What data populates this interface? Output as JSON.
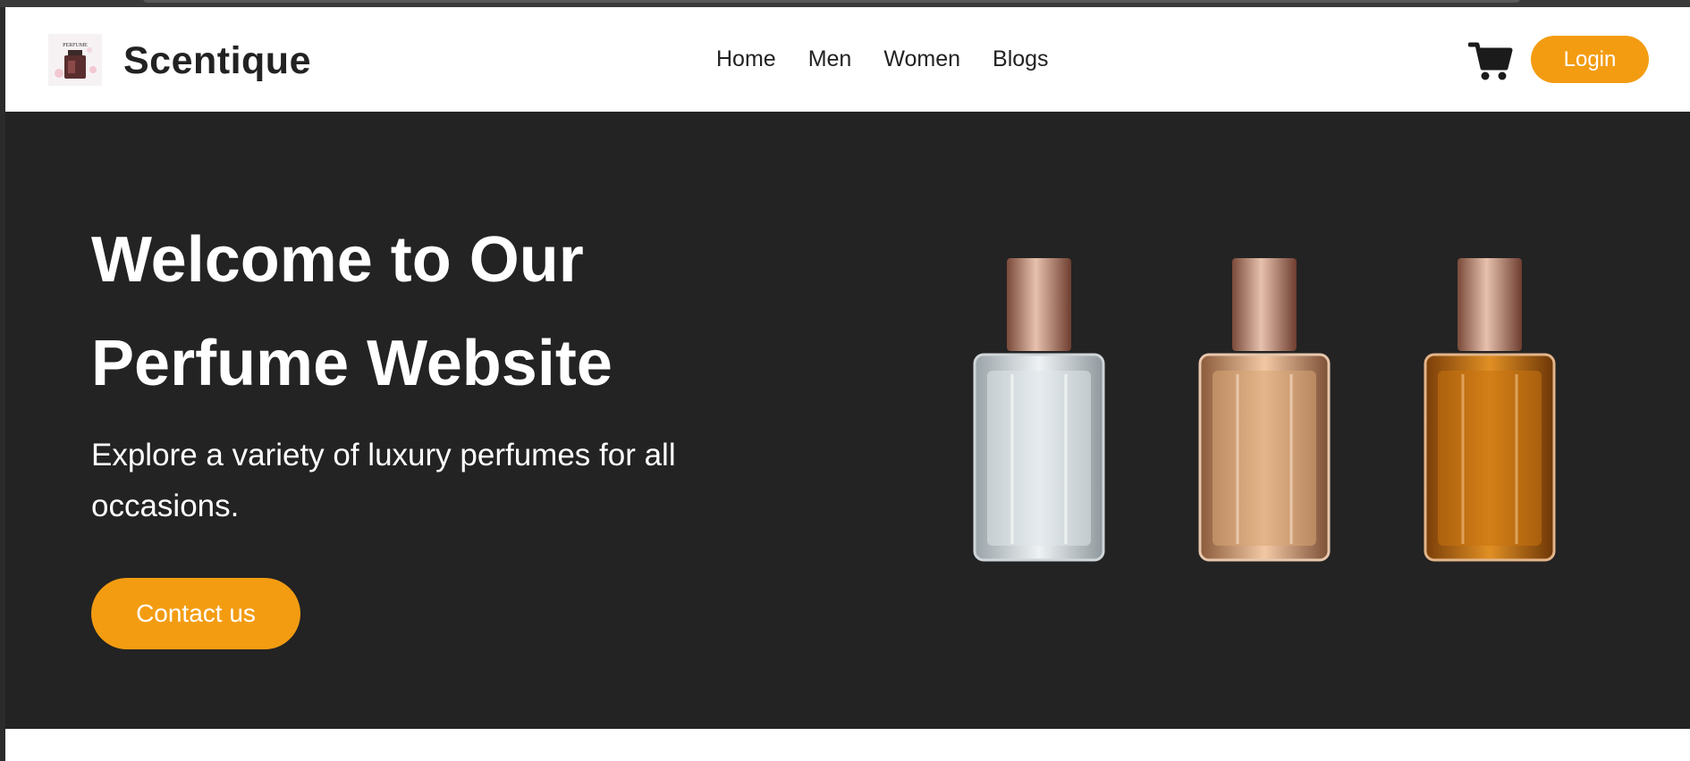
{
  "brand": {
    "name": "Scentique",
    "logo_text": "PERFUME"
  },
  "nav": {
    "links": [
      {
        "label": "Home"
      },
      {
        "label": "Men"
      },
      {
        "label": "Women"
      },
      {
        "label": "Blogs"
      }
    ],
    "cart_icon": "shopping-cart-icon",
    "login_label": "Login"
  },
  "hero": {
    "title_line1": "Welcome to Our",
    "title_line2": "Perfume Website",
    "subtitle": "Explore a variety of luxury perfumes for all occasions.",
    "cta_label": "Contact us"
  },
  "colors": {
    "accent": "#f39c12",
    "hero_bg": "#232323",
    "nav_bg": "#ffffff",
    "text_dark": "#222222"
  },
  "products": [
    {
      "name": "clear-perfume-bottle",
      "liquid": "#dfe6ea"
    },
    {
      "name": "peach-perfume-bottle",
      "liquid": "#d9a574"
    },
    {
      "name": "amber-perfume-bottle",
      "liquid": "#c9720f"
    }
  ]
}
